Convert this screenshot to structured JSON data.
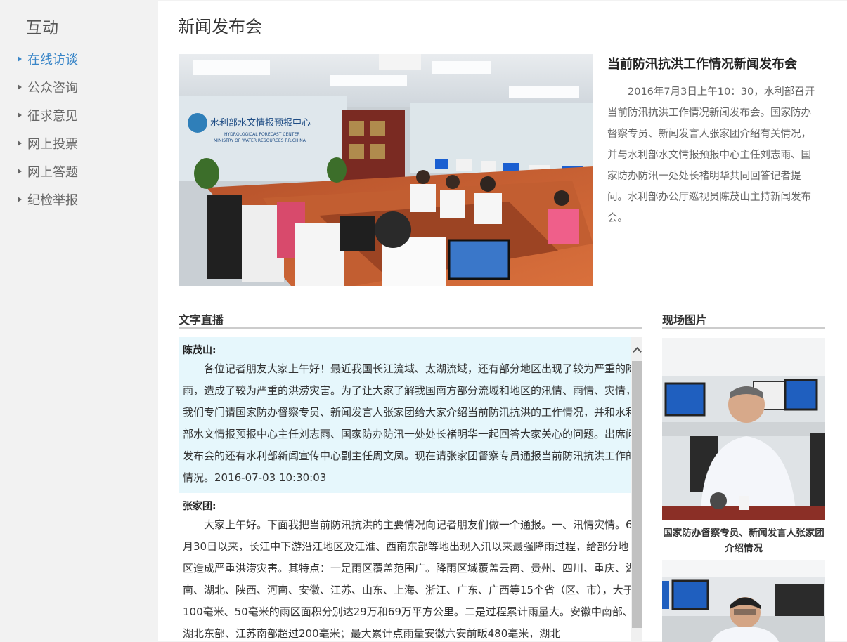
{
  "sidebar": {
    "title": "互动",
    "items": [
      {
        "label": "在线访谈",
        "active": true
      },
      {
        "label": "公众咨询",
        "active": false
      },
      {
        "label": "征求意见",
        "active": false
      },
      {
        "label": "网上投票",
        "active": false
      },
      {
        "label": "网上答题",
        "active": false
      },
      {
        "label": "纪检举报",
        "active": false
      }
    ]
  },
  "main": {
    "page_title": "新闻发布会",
    "lead": {
      "title": "当前防汛抗洪工作情况新闻发布会",
      "text": "2016年7月3日上午10：30，水利部召开当前防汛抗洪工作情况新闻发布会。国家防办督察专员、新闻发言人张家团介绍有关情况，并与水利部水文情报预报中心主任刘志雨、国家防办防汛一处处长褚明华共同回答记者提问。水利部办公厅巡视员陈茂山主持新闻发布会。"
    },
    "hero_sign": {
      "cn": "水利部水文情报预报中心",
      "en1": "HYDROLOGICAL FORECAST CENTER",
      "en2": "MINISTRY OF WATER RESOURCES P.R.CHINA"
    },
    "live": {
      "header": "文字直播",
      "entries": [
        {
          "speaker": "陈茂山:",
          "text": "各位记者朋友大家上午好！最近我国长江流域、太湖流域，还有部分地区出现了较为严重的降雨，造成了较为严重的洪涝灾害。为了让大家了解我国南方部分流域和地区的汛情、雨情、灾情，我们专门请国家防办督察专员、新闻发言人张家团给大家介绍当前防汛抗洪的工作情况，并和水利部水文情报预报中心主任刘志雨、国家防办防汛一处处长褚明华一起回答大家关心的问题。出席问发布会的还有水利部新闻宣传中心副主任周文凤。现在请张家团督察专员通报当前防汛抗洪工作的情况。2016-07-03 10:30:03"
        },
        {
          "speaker": "张家团:",
          "text": "大家上午好。下面我把当前防汛抗洪的主要情况向记者朋友们做一个通报。一、汛情灾情。6月30日以来，长江中下游沿江地区及江淮、西南东部等地出现入汛以来最强降雨过程，给部分地区造成严重洪涝灾害。其特点：一是雨区覆盖范围广。降雨区域覆盖云南、贵州、四川、重庆、湖南、湖北、陕西、河南、安徽、江苏、山东、上海、浙江、广东、广西等15个省（区、市），大于100毫米、50毫米的雨区面积分别达29万和69万平方公里。二是过程累计雨量大。安徽中南部、湖北东部、江苏南部超过200毫米；最大累计点雨量安徽六安前畈480毫米，湖北"
        }
      ]
    },
    "photos": {
      "header": "现场图片",
      "items": [
        {
          "caption": "国家防办督察专员、新闻发言人张家团介绍情况"
        },
        {
          "caption": ""
        }
      ]
    }
  }
}
